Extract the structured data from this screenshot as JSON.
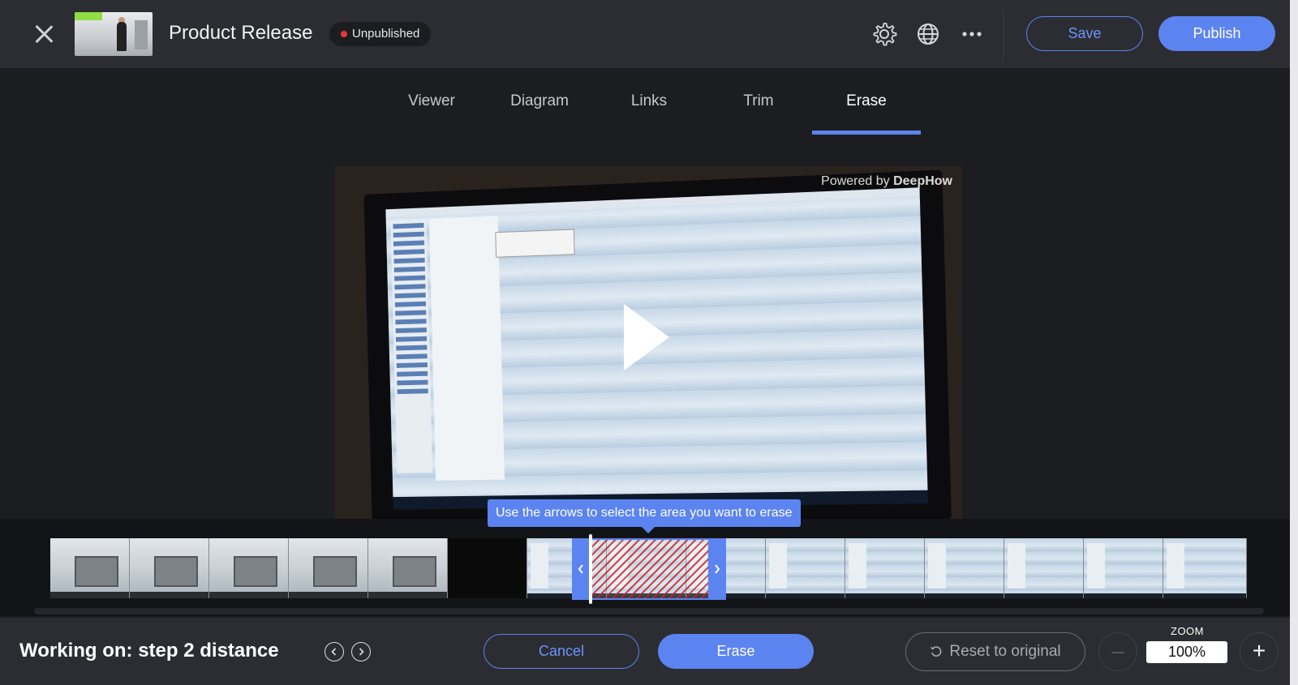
{
  "header": {
    "title": "Product Release",
    "status": "Unpublished",
    "save_label": "Save",
    "publish_label": "Publish"
  },
  "tabs": [
    {
      "label": "Viewer",
      "active": false
    },
    {
      "label": "Diagram",
      "active": false
    },
    {
      "label": "Links",
      "active": false
    },
    {
      "label": "Trim",
      "active": false
    },
    {
      "label": "Erase",
      "active": true
    }
  ],
  "video": {
    "watermark_prefix": "Powered by ",
    "watermark_brand": "DeepHow"
  },
  "timeline": {
    "hint": "Use the arrows to select the area you want to erase"
  },
  "footer": {
    "working_on": "Working on: step 2 distance",
    "cancel_label": "Cancel",
    "erase_label": "Erase",
    "reset_label": "Reset to original",
    "zoom_label": "ZOOM",
    "zoom_value": "100%"
  },
  "colors": {
    "accent": "#5b84f0",
    "status_dot": "#e53935",
    "background": "#1c1d21",
    "bar": "#2c2d32"
  },
  "icons": [
    "close-icon",
    "settings-gear-icon",
    "globe-icon",
    "more-dots-icon",
    "play-icon",
    "chevron-left-icon",
    "chevron-right-icon",
    "reset-icon",
    "minus-icon",
    "plus-icon"
  ]
}
